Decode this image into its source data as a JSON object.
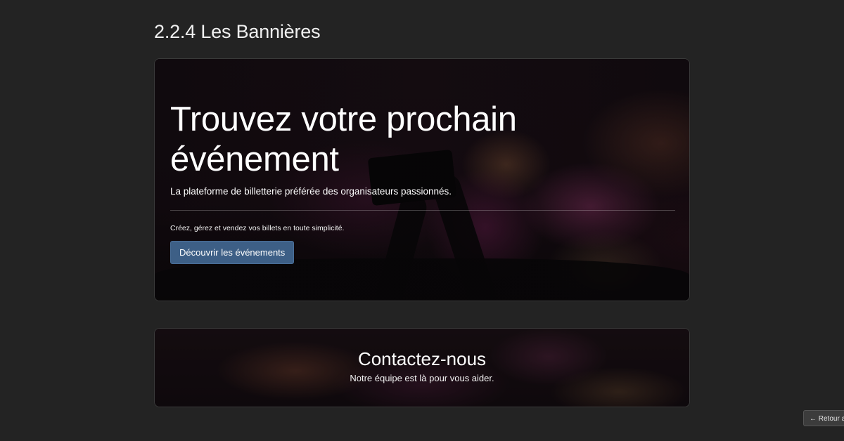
{
  "section": {
    "title": "2.2.4 Les Bannières"
  },
  "hero_banner": {
    "title": "Trouvez votre prochain événement",
    "subtitle": "La plateforme de billetterie préférée des organisateurs passionnés.",
    "text": "Créez, gérez et vendez vos billets en toute simplicité.",
    "button_label": "Découvrir les événements"
  },
  "contact_banner": {
    "title": "Contactez-nous",
    "subtitle": "Notre équipe est là pour vous aider."
  },
  "back_button": {
    "label": "← Retour a"
  },
  "colors": {
    "page_background": "#232323",
    "button_primary": "#3d5f86"
  }
}
